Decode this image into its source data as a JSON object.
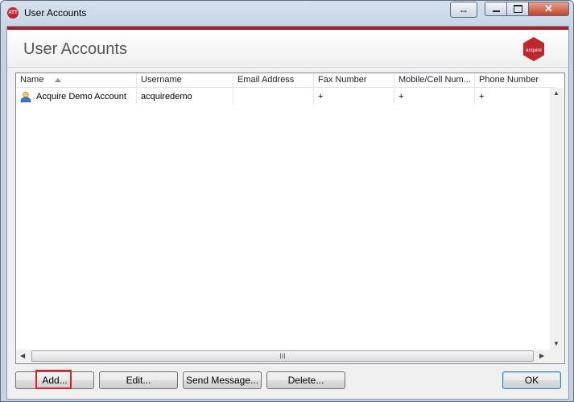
{
  "window": {
    "title": "User Accounts",
    "app_icon_text": "ATT"
  },
  "header": {
    "title": "User Accounts",
    "logo_text": "acquire"
  },
  "list": {
    "columns": [
      {
        "label": "Name",
        "sorted": "ascending"
      },
      {
        "label": "Username"
      },
      {
        "label": "Email Address"
      },
      {
        "label": "Fax Number"
      },
      {
        "label": "Mobile/Cell Num..."
      },
      {
        "label": "Phone Number"
      }
    ],
    "rows": [
      {
        "name": "Acquire Demo Account",
        "username": "acquiredemo",
        "email": "",
        "fax": "+",
        "mobile": "+",
        "phone": "+"
      }
    ],
    "hscroll_grip": "III"
  },
  "buttons": {
    "add": "Add...",
    "edit": "Edit...",
    "send_message": "Send Message...",
    "delete": "Delete...",
    "ok": "OK"
  },
  "colors": {
    "accent_red": "#a4222a",
    "logo_red": "#c0272d",
    "focus_ring": "#e01f26"
  }
}
